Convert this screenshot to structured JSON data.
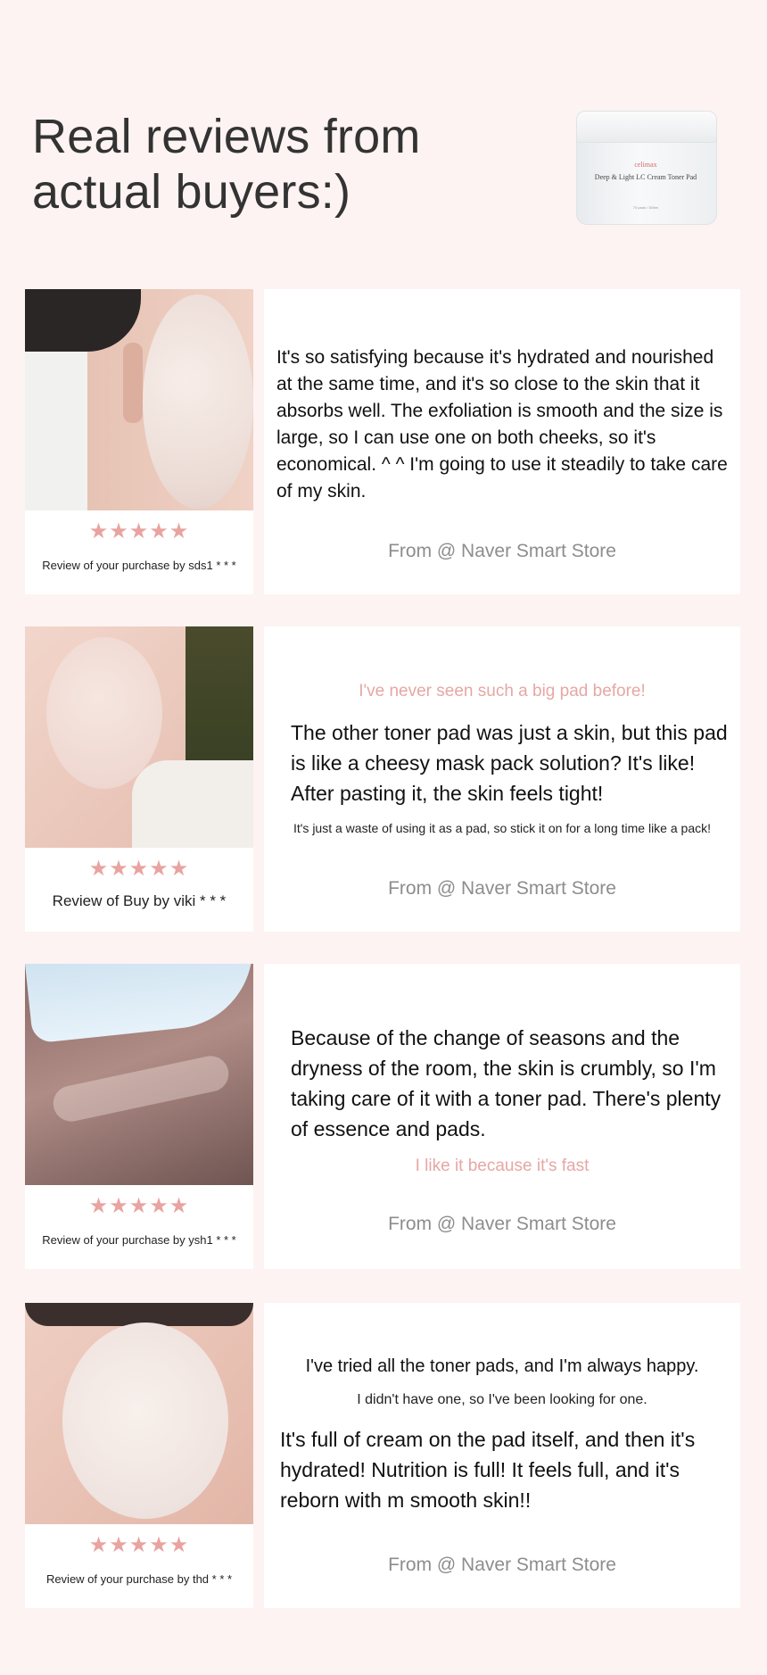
{
  "header": {
    "title": "Real reviews from actual buyers:)",
    "product": {
      "brand": "celimax",
      "name": "Deep & Light LC Cream Toner Pad",
      "spec": "70 pads / 300ml"
    }
  },
  "reviews": [
    {
      "stars": "★★★★★",
      "author": "Review of your purchase by sds1 * * *",
      "text": "It's so satisfying because it's hydrated and nourished at the same time, and it's so close to the skin that it absorbs well. The exfoliation is smooth and the size is large, so I can use one on both cheeks, so it's economical. ^ ^ I'm going to use it steadily to take care of my skin.",
      "source": "From @ Naver Smart Store"
    },
    {
      "stars": "★★★★★",
      "author": "Review of Buy by viki * * *",
      "highlight": "I've never seen such a big pad before!",
      "text": "The other toner pad was just a skin, but this pad is like a cheesy mask pack solution? It's like! After pasting it, the skin feels tight!",
      "small": "It's just a waste of using it as a pad, so stick it on for a long time like a pack!",
      "source": "From @ Naver Smart Store"
    },
    {
      "stars": "★★★★★",
      "author": "Review of your purchase by ysh1 * * *",
      "text": "Because of the change of seasons and the dryness of the room, the skin is crumbly, so I'm taking care of it with a toner pad. There's plenty of essence and pads.",
      "highlight": "I like it because it's fast",
      "source": "From @ Naver Smart Store"
    },
    {
      "stars": "★★★★★",
      "author": "Review of your purchase by thd * * *",
      "line1": "I've tried all the toner pads, and I'm always happy.",
      "small": "I didn't have one, so I've been looking for one.",
      "text": "It's full of cream on the pad itself, and then it's hydrated! Nutrition is full! It feels full, and it's reborn with m smooth skin!!",
      "source": "From @ Naver Smart Store"
    }
  ],
  "colors": {
    "background": "#fdf3f2",
    "star": "#e9a3a0",
    "highlight": "#e6a7a4",
    "source": "#8d8d8d"
  }
}
